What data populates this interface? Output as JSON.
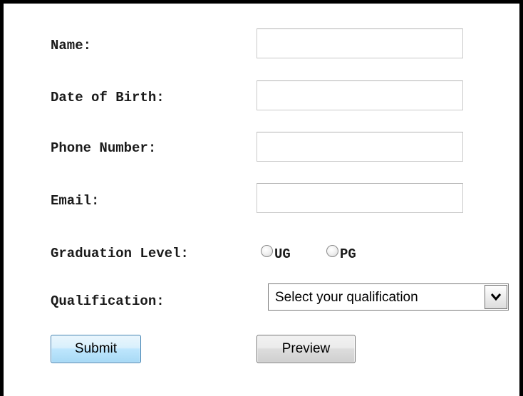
{
  "form": {
    "name_label": "Name:",
    "name_value": "",
    "dob_label": "Date of Birth:",
    "dob_value": "",
    "phone_label": "Phone Number:",
    "phone_value": "",
    "email_label": "Email:",
    "email_value": "",
    "graduation_label": "Graduation Level:",
    "graduation_options": [
      "UG",
      "PG"
    ],
    "qualification_label": "Qualification:",
    "qualification_selected": "Select your qualification",
    "submit_label": "Submit",
    "preview_label": "Preview"
  },
  "colors": {
    "frame_border": "#000000",
    "submit_border": "#3c7fb1",
    "submit_fill": "#bee6fd",
    "preview_fill": "#dddddd",
    "input_border": "#c9c9c9"
  },
  "icons": {
    "select_arrow": "chevron-down-icon"
  }
}
